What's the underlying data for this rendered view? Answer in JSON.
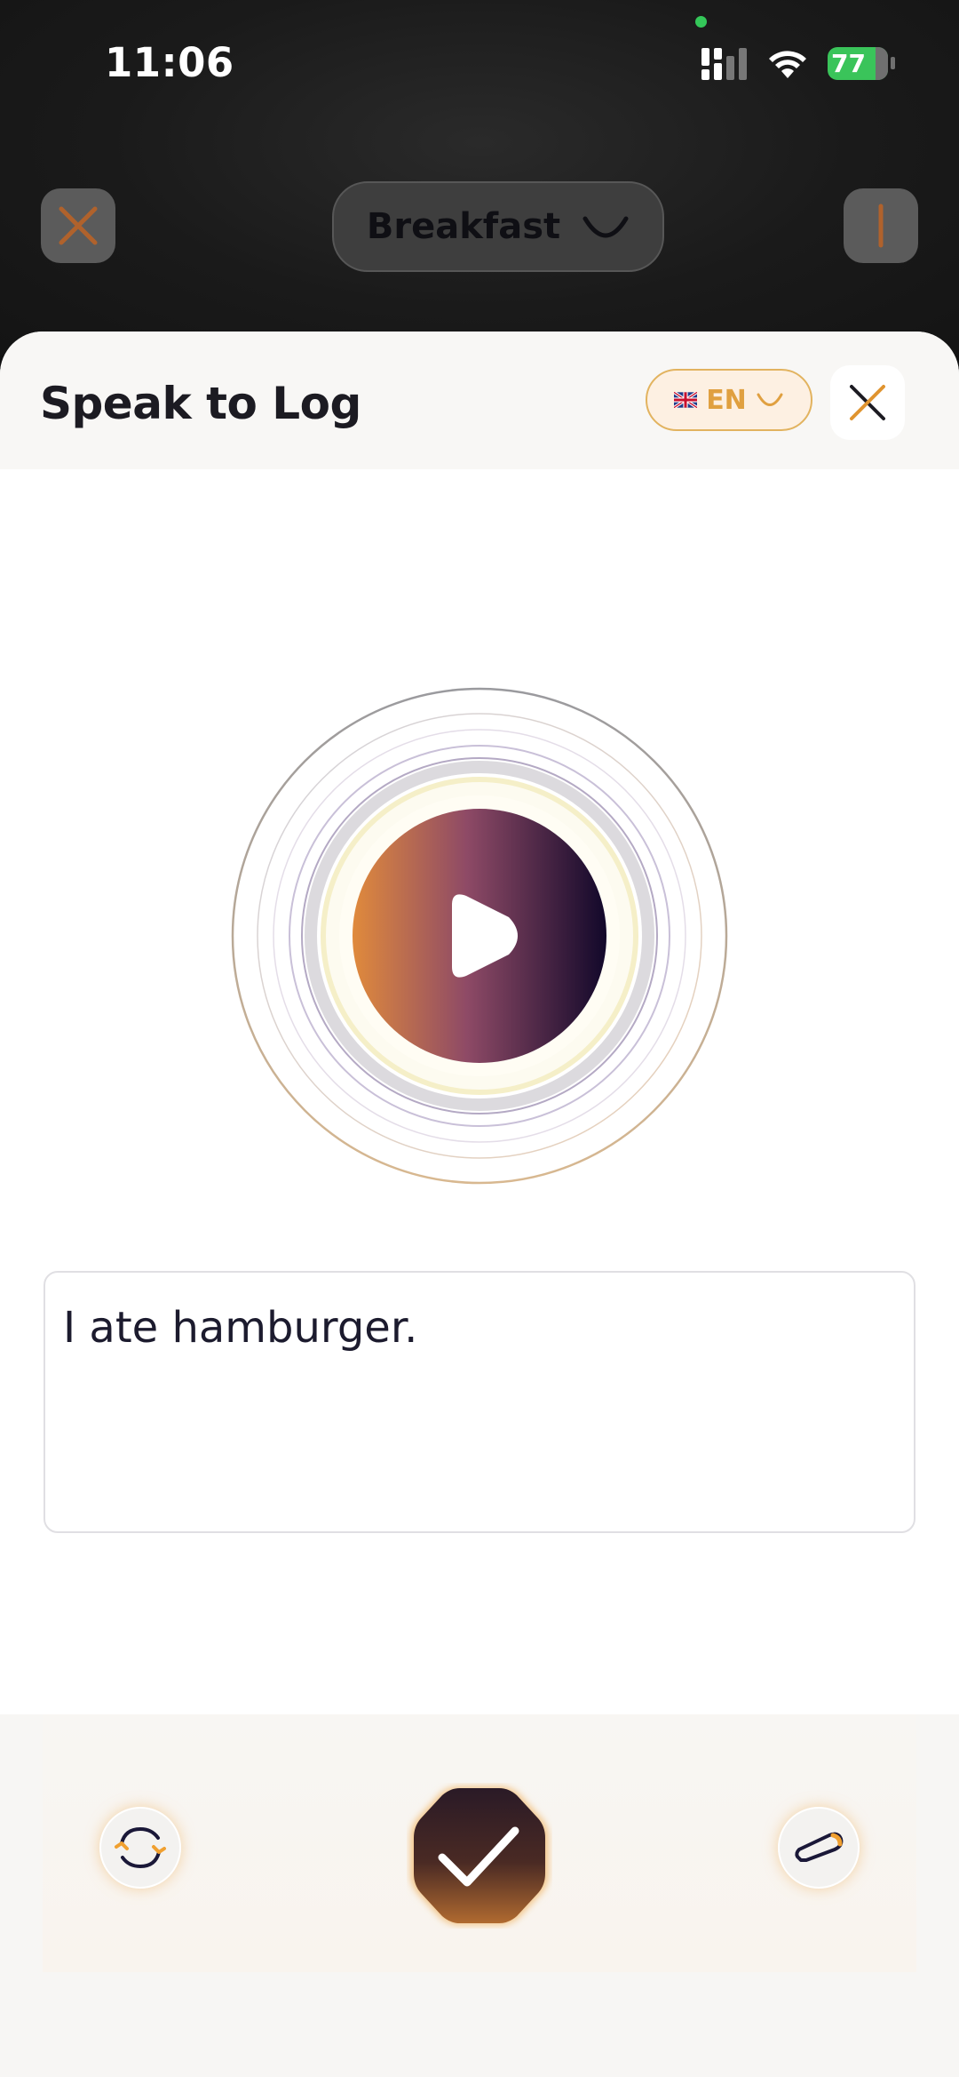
{
  "status_bar": {
    "time": "11:06",
    "battery": "77"
  },
  "background_screen": {
    "meal_label": "Breakfast"
  },
  "sheet": {
    "title": "Speak to Log",
    "language": {
      "code": "EN",
      "flag": "uk-flag"
    }
  },
  "transcript": {
    "text": "I ate hamburger."
  },
  "icons": {
    "close": "close-icon",
    "info": "info-icon",
    "play": "play-icon",
    "retry": "refresh-icon",
    "confirm": "check-icon",
    "edit": "edit-icon"
  },
  "colors": {
    "accent_orange": "#e0a040",
    "orb_start": "#e08a3c",
    "orb_mid": "#8e4a66",
    "orb_end": "#12082a",
    "confirm_dark": "#2a1a26",
    "confirm_light": "#b06a30"
  }
}
